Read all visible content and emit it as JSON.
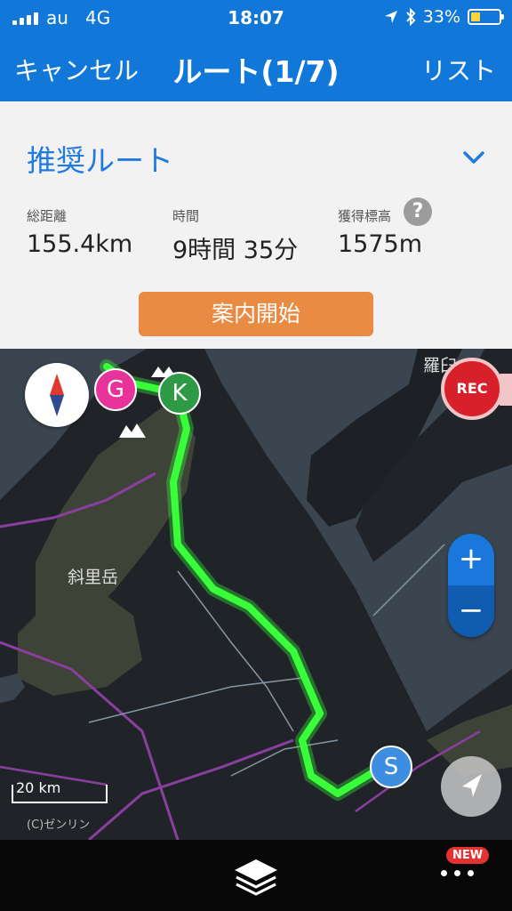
{
  "status_bar": {
    "carrier": "au",
    "network": "4G",
    "time": "18:07",
    "battery": "33%",
    "battery_fraction": 0.33
  },
  "nav": {
    "cancel_label": "キャンセル",
    "title": "ルート(1/7)",
    "list_label": "リスト"
  },
  "route": {
    "name": "推奨ルート",
    "stats": [
      {
        "label": "総距離",
        "value": "155.4km"
      },
      {
        "label": "時間",
        "value": "9時間 35分"
      },
      {
        "label": "獲得標高",
        "value": "1575m"
      }
    ],
    "help_label": "?",
    "start_button": "案内開始"
  },
  "map": {
    "place_labels": [
      "斜里岳",
      "羅臼"
    ],
    "rec_label": "REC",
    "zoom_in": "+",
    "zoom_out": "−",
    "scale_label": "20 km",
    "copyright": "(C)ゼンリン",
    "markers": [
      {
        "label": "G",
        "color": "#e8339a"
      },
      {
        "label": "K",
        "color": "#2f9a45"
      },
      {
        "label": "S",
        "color": "#3d8ee0"
      }
    ],
    "route_color": "#39ff3a"
  },
  "tabbar": {
    "new_badge": "NEW"
  },
  "colors": {
    "accent": "#1177d8",
    "start_button": "#e98b42",
    "rec": "#d8202a"
  }
}
